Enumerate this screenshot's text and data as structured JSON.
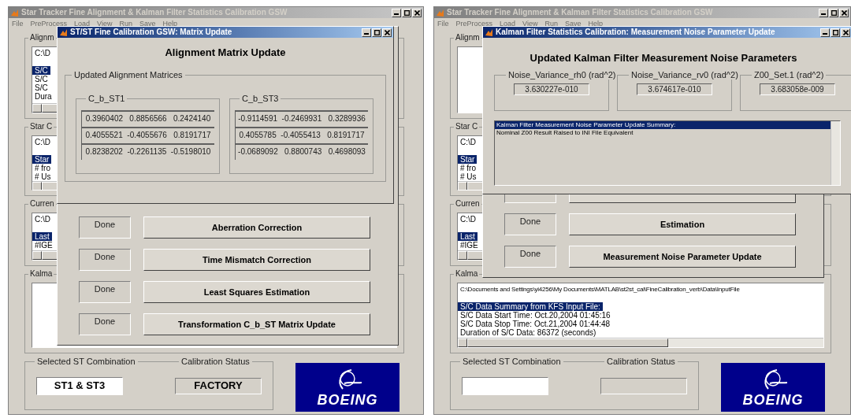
{
  "screens": [
    {
      "main_window": {
        "title": "Star Tracker Fine Alignment & Kalman Filter Statistics Calibration GSW",
        "menu": [
          "File",
          "PreProcess",
          "Load",
          "View",
          "Run",
          "Save",
          "Help"
        ],
        "groups": [
          {
            "label": "Alignm",
            "path": "C:\\D",
            "lines": [
              {
                "text": "S/C",
                "selected": true
              },
              {
                "text": "S/C",
                "selected": false
              },
              {
                "text": "S/C",
                "selected": false
              },
              {
                "text": "Dura",
                "selected": false
              }
            ]
          },
          {
            "label": "Star C",
            "path": "C:\\D",
            "lines": [
              {
                "text": "Star",
                "selected": true
              },
              {
                "text": "# fro",
                "selected": false
              },
              {
                "text": "# Us",
                "selected": false
              }
            ]
          },
          {
            "label": "Curren",
            "path": "C:\\D",
            "lines": [
              {
                "text": "Last",
                "selected": true
              },
              {
                "text": "#IGE",
                "selected": false
              }
            ]
          },
          {
            "label": "Kalma"
          }
        ],
        "selection": {
          "label": "Selected ST Combination",
          "value": "ST1 & ST3"
        },
        "status": {
          "label": "Calibration Status",
          "value": "FACTORY"
        },
        "logo": "BOEING"
      },
      "process_window": {
        "steps": [
          {
            "kind": "step",
            "status": "Done",
            "button": "Aberration Correction"
          },
          {
            "kind": "step",
            "status": "Done",
            "button": "Time Mismatch Correction"
          },
          {
            "kind": "step",
            "status": "Done",
            "button": "Least Squares Estimation"
          },
          {
            "kind": "step",
            "status": "Done",
            "button": "Transformation C_b_ST Matrix Update"
          }
        ]
      },
      "dialog": {
        "kind": "matrix",
        "title": "ST/ST Fine Calibration GSW: Matrix Update",
        "heading": "Alignment Matrix Update",
        "panel_label": "Updated Alignment Matrices",
        "matrices": [
          {
            "label": "C_b_ST1",
            "rows": [
              "0.3960402   0.8856566   0.2424140",
              "0.4055521  -0.4055676   0.8191717",
              "0.8238202  -0.2261135  -0.5198010"
            ]
          },
          {
            "label": "C_b_ST3",
            "rows": [
              "-0.9114591  -0.2469931   0.3289936",
              "0.4055785  -0.4055413   0.8191717",
              "-0.0689092   0.8800743   0.4698093"
            ]
          }
        ]
      }
    },
    {
      "main_window": {
        "title": "Star Tracker Fine Alignment & Kalman Filter Statistics Calibration GSW",
        "menu": [
          "File",
          "PreProcess",
          "Load",
          "View",
          "Run",
          "Save",
          "Help"
        ],
        "groups": [
          {
            "label": "Alignm"
          },
          {
            "label": "Star C",
            "path": "C:\\D",
            "lines": [
              {
                "text": "Star",
                "selected": true
              },
              {
                "text": "# fro",
                "selected": false
              },
              {
                "text": "# Us",
                "selected": false
              }
            ]
          },
          {
            "label": "Curren",
            "path": "C:\\D",
            "lines": [
              {
                "text": "Last",
                "selected": true
              },
              {
                "text": "#IGE",
                "selected": false
              }
            ]
          },
          {
            "label": "Kalma",
            "path": "C:\\Documents and Settings\\yi4256\\My Documents\\MATLAB\\st2st_cal\\FineCalibration_verb\\Data\\InputFile",
            "lines": [
              {
                "text": "S/C Data Summary from KFS Input File:",
                "selected": true
              },
              {
                "text": "S/C Data Start Time:   Oct.20,2004 01:45:16",
                "selected": false
              },
              {
                "text": "S/C Data Stop Time:   Oct.21,2004 01:44:48",
                "selected": false
              },
              {
                "text": "Duration of S/C Data:   86372 (seconds)",
                "selected": false
              }
            ]
          }
        ],
        "selection": {
          "label": "Selected ST Combination"
        },
        "status": {
          "label": "Calibration Status"
        },
        "logo": "BOEING"
      },
      "process_window": {
        "steps": [
          {
            "kind": "cut"
          },
          {
            "kind": "step",
            "status": "Done",
            "button": "Estimation"
          },
          {
            "kind": "step",
            "status": "Done",
            "button": "Measurement Noise Parameter Update"
          }
        ]
      },
      "dialog": {
        "kind": "noise",
        "title": "Kalman Filter Statistics Calibration: Measurement Noise Parameter Update",
        "heading": "Updated Kalman Filter Measurement Noise Parameters",
        "params": [
          {
            "label": "Noise_Variance_rh0 (rad^2)",
            "value": "3.630227e-010"
          },
          {
            "label": "Noise_Variance_rv0 (rad^2)",
            "value": "3.674617e-010"
          },
          {
            "label": "Z00_Set.1 (rad^2)",
            "value": "3.683058e-009"
          }
        ],
        "summary": [
          {
            "text": "Kalman Filter Measurement Noise Parameter Update Summary:",
            "selected": true
          },
          {
            "text": "Nominal Z00 Result Raised to INI File Equivalent",
            "selected": false
          }
        ]
      }
    }
  ]
}
